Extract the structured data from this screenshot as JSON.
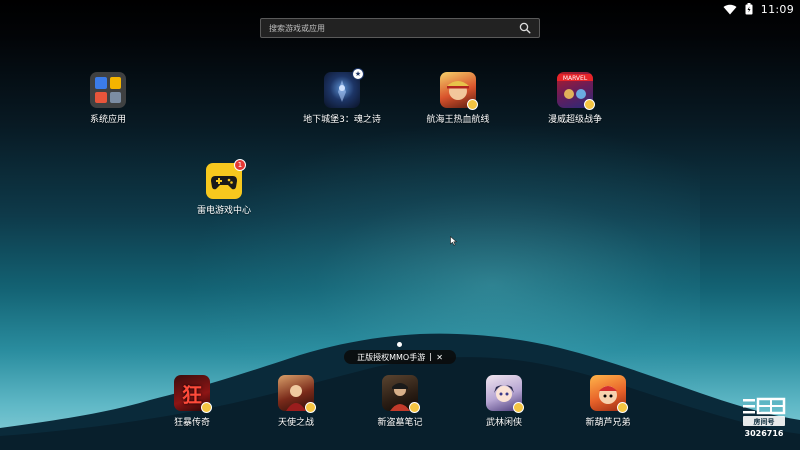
{
  "status": {
    "time": "11:09"
  },
  "search": {
    "placeholder": "搜索游戏或应用"
  },
  "apps": [
    {
      "label": "系统应用"
    },
    {
      "label": "地下城堡3：魂之诗"
    },
    {
      "label": "航海王热血航线"
    },
    {
      "label": "漫威超级战争"
    },
    {
      "label": "雷电游戏中心",
      "badge": "1"
    }
  ],
  "promo": {
    "text": "正版授权MMO手游",
    "close": "✕"
  },
  "dock": [
    {
      "label": "狂暴传奇",
      "glyph": "狂"
    },
    {
      "label": "天使之战"
    },
    {
      "label": "新盗墓笔记"
    },
    {
      "label": "武林闲侠"
    },
    {
      "label": "新葫芦兄弟"
    }
  ],
  "watermark": {
    "room": "3026716",
    "logo_text": "房间号"
  },
  "colors": {
    "accent": "#f5c542",
    "badge": "#e53935"
  },
  "icons": [
    "wifi-icon",
    "battery-icon",
    "search-icon",
    "gamepad-icon",
    "close-icon",
    "cursor-icon"
  ]
}
